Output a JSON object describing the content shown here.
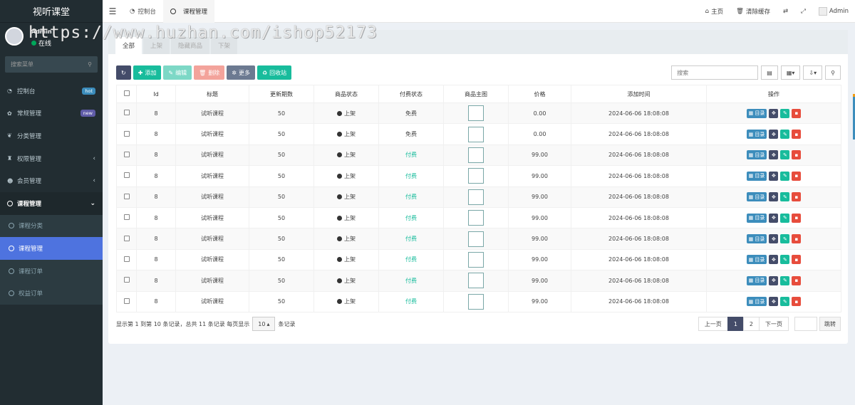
{
  "sidebar": {
    "brand": "视听课堂",
    "user": {
      "name": "Admin",
      "status": "在线"
    },
    "search_placeholder": "搜索菜单",
    "menu": [
      {
        "icon": "dashboard-icon",
        "glyph": "◔",
        "label": "控制台",
        "badge": "hot",
        "badge_type": "hot"
      },
      {
        "icon": "cogs-icon",
        "glyph": "✿",
        "label": "常规管理",
        "badge": "new",
        "badge_type": "new"
      },
      {
        "icon": "leaf-icon",
        "glyph": "❦",
        "label": "分类管理"
      },
      {
        "icon": "group-icon",
        "glyph": "♜",
        "label": "权限管理",
        "chevron": "‹"
      },
      {
        "icon": "user-circle-icon",
        "glyph": "☻",
        "label": "会员管理",
        "chevron": "‹"
      },
      {
        "icon": "circle-icon",
        "label": "课程管理",
        "chevron": "⌄",
        "open": true
      },
      {
        "icon": "circle-icon",
        "label": "课程分类",
        "sub": true
      },
      {
        "icon": "circle-icon",
        "label": "课程管理",
        "sub": true,
        "active": true
      },
      {
        "icon": "circle-icon",
        "label": "课程订单",
        "sub": true
      },
      {
        "icon": "circle-icon",
        "label": "权益订单",
        "sub": true
      }
    ]
  },
  "header": {
    "tabs": [
      {
        "label": "控制台",
        "icon": "dashboard-icon"
      },
      {
        "label": "课程管理",
        "icon": "circle-icon",
        "active": true
      }
    ],
    "right": {
      "home": "主页",
      "clear_cache": "清除缓存",
      "admin": "Admin"
    }
  },
  "watermark": "https://www.huzhan.com/ishop52173",
  "panel": {
    "tabs": [
      "全部",
      "上架",
      "隐藏商品",
      "下架"
    ],
    "toolbar": {
      "add": "添加",
      "edit": "编辑",
      "delete": "删除",
      "more": "更多",
      "recycle": "回收站",
      "search_placeholder": "搜索"
    },
    "columns": [
      "Id",
      "标题",
      "更新期数",
      "商品状态",
      "付费状态",
      "商品主图",
      "价格",
      "添加时间",
      "操作"
    ],
    "rows": [
      {
        "id": "8",
        "title": "试听课程",
        "periods": "50",
        "status": "上架",
        "pay": "免费",
        "paid": false,
        "price": "0.00",
        "time": "2024-06-06 18:08:08"
      },
      {
        "id": "8",
        "title": "试听课程",
        "periods": "50",
        "status": "上架",
        "pay": "免费",
        "paid": false,
        "price": "0.00",
        "time": "2024-06-06 18:08:08"
      },
      {
        "id": "8",
        "title": "试听课程",
        "periods": "50",
        "status": "上架",
        "pay": "付费",
        "paid": true,
        "price": "99.00",
        "time": "2024-06-06 18:08:08"
      },
      {
        "id": "8",
        "title": "试听课程",
        "periods": "50",
        "status": "上架",
        "pay": "付费",
        "paid": true,
        "price": "99.00",
        "time": "2024-06-06 18:08:08"
      },
      {
        "id": "8",
        "title": "试听课程",
        "periods": "50",
        "status": "上架",
        "pay": "付费",
        "paid": true,
        "price": "99.00",
        "time": "2024-06-06 18:08:08"
      },
      {
        "id": "8",
        "title": "试听课程",
        "periods": "50",
        "status": "上架",
        "pay": "付费",
        "paid": true,
        "price": "99.00",
        "time": "2024-06-06 18:08:08"
      },
      {
        "id": "8",
        "title": "试听课程",
        "periods": "50",
        "status": "上架",
        "pay": "付费",
        "paid": true,
        "price": "99.00",
        "time": "2024-06-06 18:08:08"
      },
      {
        "id": "8",
        "title": "试听课程",
        "periods": "50",
        "status": "上架",
        "pay": "付费",
        "paid": true,
        "price": "99.00",
        "time": "2024-06-06 18:08:08"
      },
      {
        "id": "8",
        "title": "试听课程",
        "periods": "50",
        "status": "上架",
        "pay": "付费",
        "paid": true,
        "price": "99.00",
        "time": "2024-06-06 18:08:08"
      },
      {
        "id": "8",
        "title": "试听课程",
        "periods": "50",
        "status": "上架",
        "pay": "付费",
        "paid": true,
        "price": "99.00",
        "time": "2024-06-06 18:08:08"
      }
    ],
    "row_action": {
      "directory": "目录"
    },
    "footer": {
      "summary_prefix": "显示第 1 到第 10 条记录，总共 11 条记录 每页显示",
      "page_size": "10",
      "summary_suffix": "条记录",
      "prev": "上一页",
      "pages": [
        "1",
        "2"
      ],
      "current_page": "1",
      "next": "下一页",
      "jump": "跳转"
    }
  },
  "colors": {
    "sidebar_bg": "#222d32",
    "accent_active": "#4e73df",
    "success": "#18bc9c",
    "danger": "#e74c3c",
    "primary": "#3c8dbc"
  }
}
